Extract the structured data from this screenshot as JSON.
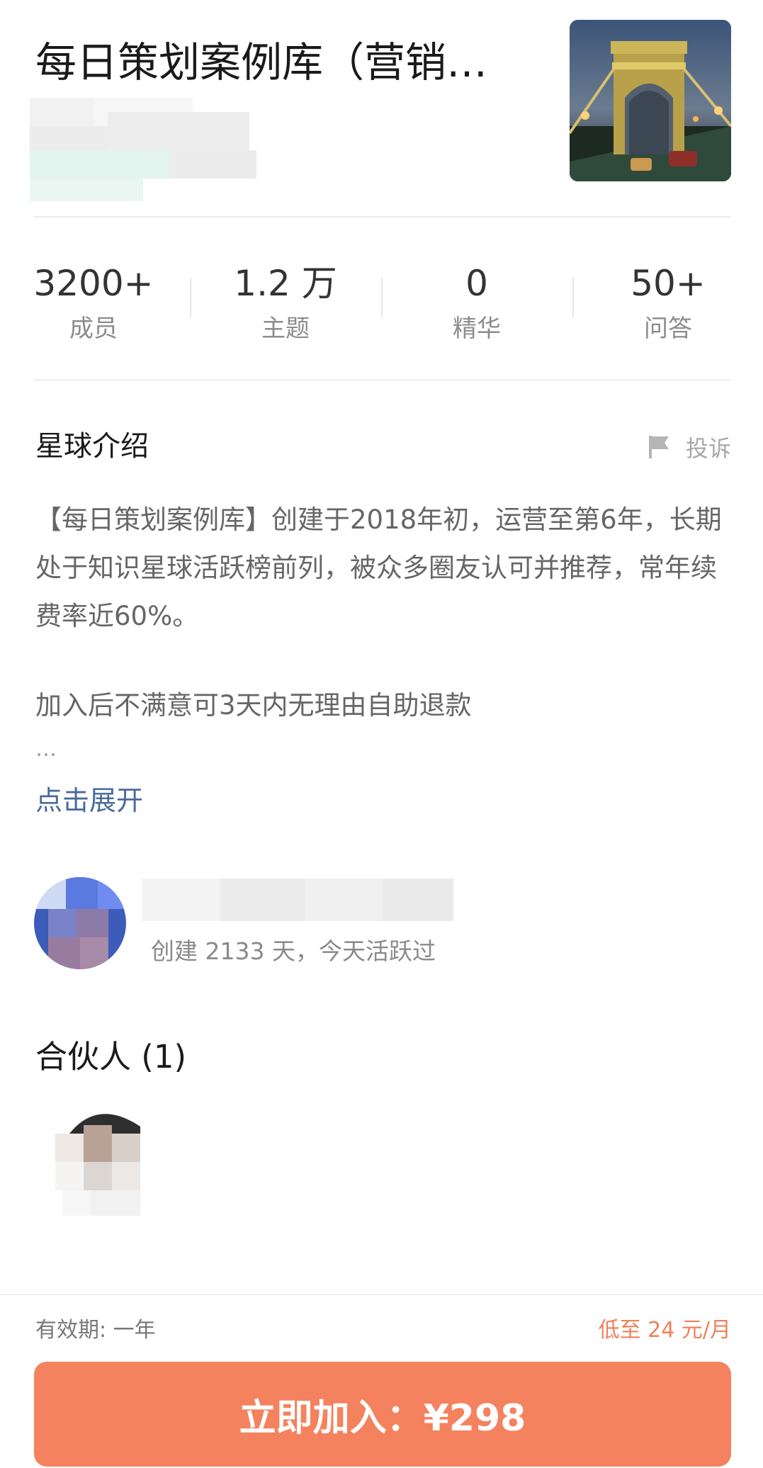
{
  "header": {
    "title": "每日策划案例库（营销…"
  },
  "stats": [
    {
      "value": "3200+",
      "label": "成员"
    },
    {
      "value": "1.2 万",
      "label": "主题"
    },
    {
      "value": "0",
      "label": "精华"
    },
    {
      "value": "50+",
      "label": "问答"
    }
  ],
  "intro": {
    "title": "星球介绍",
    "report_label": "投诉",
    "paragraphs": [
      "【每日策划案例库】创建于2018年初，运营至第6年，长期处于知识星球活跃榜前列，被众多圈友认可并推荐，常年续费率近60%。",
      "加入后不满意可3天内无理由自助退款"
    ],
    "ellipsis": "…",
    "expand_label": "点击展开"
  },
  "owner": {
    "created_text": "创建 2133 天，今天活跃过"
  },
  "partners": {
    "title": "合伙人 (1)"
  },
  "footer": {
    "validity": "有效期: 一年",
    "price_note": "低至 24 元/月",
    "join_label": "立即加入：¥298"
  },
  "colors": {
    "accent": "#f4825e",
    "link": "#4a6a9e",
    "muted": "#8c8c8c"
  }
}
